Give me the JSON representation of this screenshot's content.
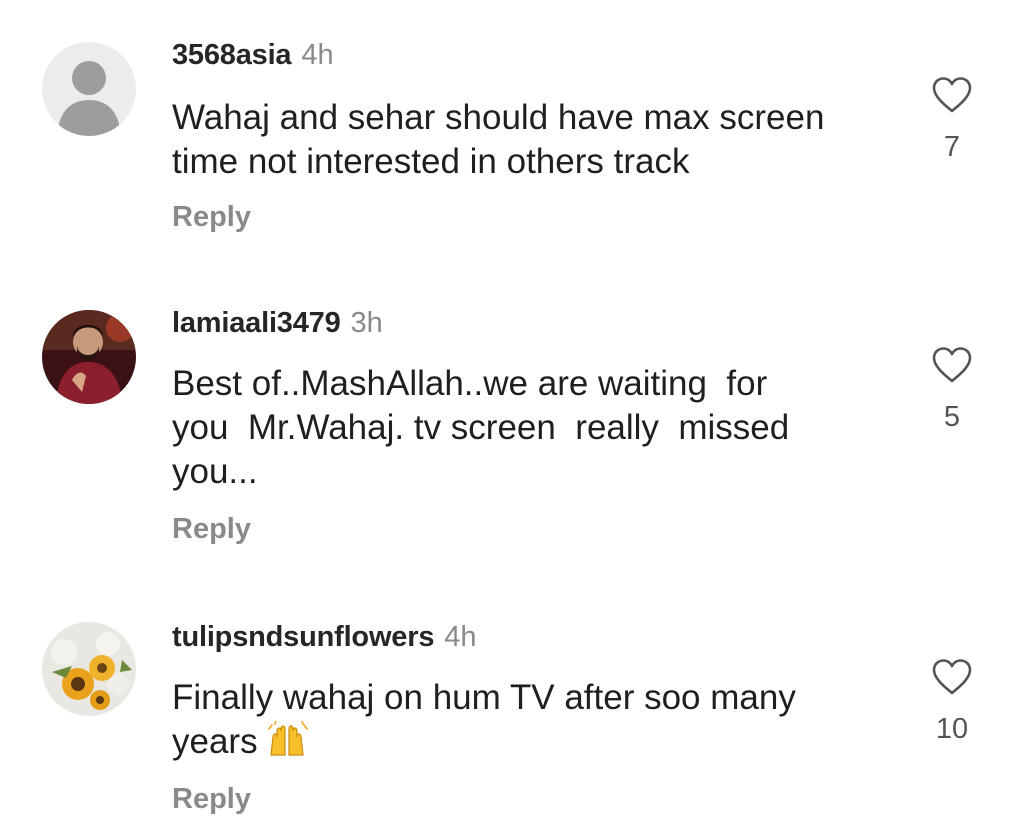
{
  "comments": [
    {
      "username": "3568asia",
      "time": "4h",
      "text": "Wahaj and sehar should have max screen\ntime not interested in others track",
      "reply_label": "Reply",
      "likes": "7",
      "avatar": "default-person-avatar"
    },
    {
      "username": "lamiaali3479",
      "time": "3h",
      "text": "Best of..MashAllah..we are waiting  for\nyou  Mr.Wahaj. tv screen  really  missed\nyou...",
      "reply_label": "Reply",
      "likes": "5",
      "avatar": "photo-man-avatar"
    },
    {
      "username": "tulipsndsunflowers",
      "time": "4h",
      "text": "Finally wahaj on hum TV after soo many\nyears",
      "emoji": "raising-hands-emoji",
      "reply_label": "Reply",
      "likes": "10",
      "avatar": "photo-sunflowers-avatar"
    }
  ],
  "colors": {
    "text": "#1f1f1f",
    "muted": "#8a8a8a",
    "heart_stroke": "#555555",
    "default_avatar_bg": "#e6e6e6",
    "default_avatar_fg": "#9a9a9a"
  }
}
